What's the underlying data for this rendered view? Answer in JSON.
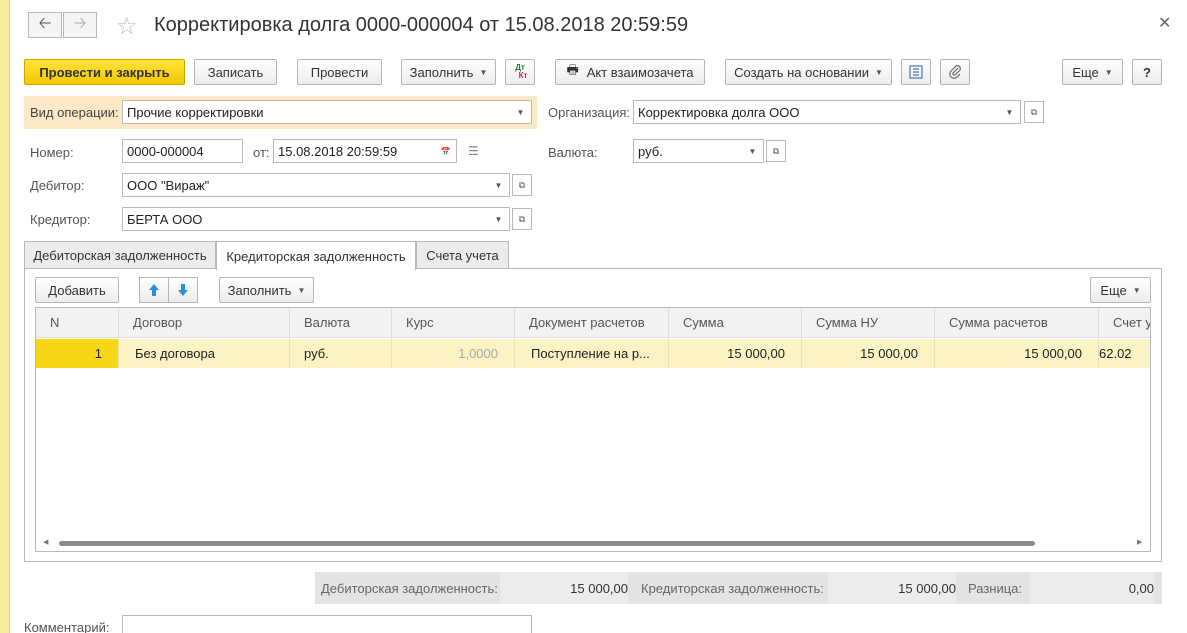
{
  "window": {
    "title": "Корректировка долга 0000-000004 от 15.08.2018 20:59:59",
    "back_icon": "arrow-left-icon",
    "forward_icon": "arrow-right-icon",
    "favorite_icon": "star-icon",
    "close_icon": "close-icon"
  },
  "toolbar": {
    "post_close": "Провести и закрыть",
    "save": "Записать",
    "post": "Провести",
    "fill": "Заполнить",
    "dtkt_top": "Дт",
    "dtkt_bottom": "Кт",
    "act_print": "Акт взаимозачета",
    "create_based": "Создать на основании",
    "more": "Еще",
    "help": "?"
  },
  "form": {
    "operation_label": "Вид операции:",
    "operation_value": "Прочие корректировки",
    "number_label": "Номер:",
    "number_value": "0000-000004",
    "date_label": "от:",
    "date_value": "15.08.2018 20:59:59",
    "debtor_label": "Дебитор:",
    "debtor_value": "ООО \"Вираж\"",
    "creditor_label": "Кредитор:",
    "creditor_value": "БЕРТА ООО",
    "org_label": "Организация:",
    "org_value": "Корректировка долга ООО",
    "currency_label": "Валюта:",
    "currency_value": "руб."
  },
  "tabs": [
    "Дебиторская задолженность",
    "Кредиторская задолженность",
    "Счета учета"
  ],
  "table_toolbar": {
    "add": "Добавить",
    "fill": "Заполнить",
    "more": "Еще"
  },
  "table": {
    "headers": [
      "N",
      "Договор",
      "Валюта",
      "Курс",
      "Документ расчетов",
      "Сумма",
      "Сумма НУ",
      "Сумма расчетов",
      "Счет у"
    ],
    "row": [
      "1",
      "Без договора",
      "руб.",
      "1,0000",
      "Поступление на р...",
      "15 000,00",
      "15 000,00",
      "15 000,00",
      "62.02"
    ]
  },
  "totals": {
    "debit_label": "Дебиторская задолженность:",
    "debit_value": "15 000,00",
    "credit_label": "Кредиторская задолженность:",
    "credit_value": "15 000,00",
    "diff_label": "Разница:",
    "diff_value": "0,00"
  },
  "comment_label": "Комментарий:",
  "colors": {
    "primary_button": "#f5c800",
    "selected_row": "#fbf3c4",
    "highlight_field": "#fbe9c6"
  }
}
